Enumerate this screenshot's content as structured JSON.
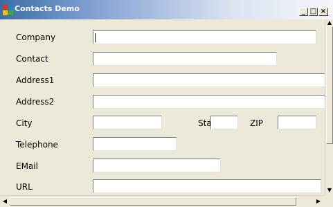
{
  "window": {
    "title": "Contacts Demo",
    "minimize_label": "_",
    "maximize_label": "□",
    "close_label": "×"
  },
  "form": {
    "company": {
      "label": "Company",
      "value": ""
    },
    "contact": {
      "label": "Contact",
      "value": ""
    },
    "address1": {
      "label": "Address1",
      "value": ""
    },
    "address2": {
      "label": "Address2",
      "value": ""
    },
    "city": {
      "label": "City",
      "value": ""
    },
    "state": {
      "label": "State",
      "value": ""
    },
    "zip": {
      "label": "ZIP",
      "value": ""
    },
    "telephone": {
      "label": "Telephone",
      "value": ""
    },
    "email": {
      "label": "EMail",
      "value": ""
    },
    "url": {
      "label": "URL",
      "value": ""
    }
  },
  "icons": {
    "app": "app-window-icon",
    "scroll_up": "▲",
    "scroll_down": "▼",
    "scroll_left": "◀",
    "scroll_right": "▶"
  },
  "colors": {
    "face": "#ece9d8",
    "title_start": "#3a6ea5",
    "field_bg": "#ffffff"
  }
}
